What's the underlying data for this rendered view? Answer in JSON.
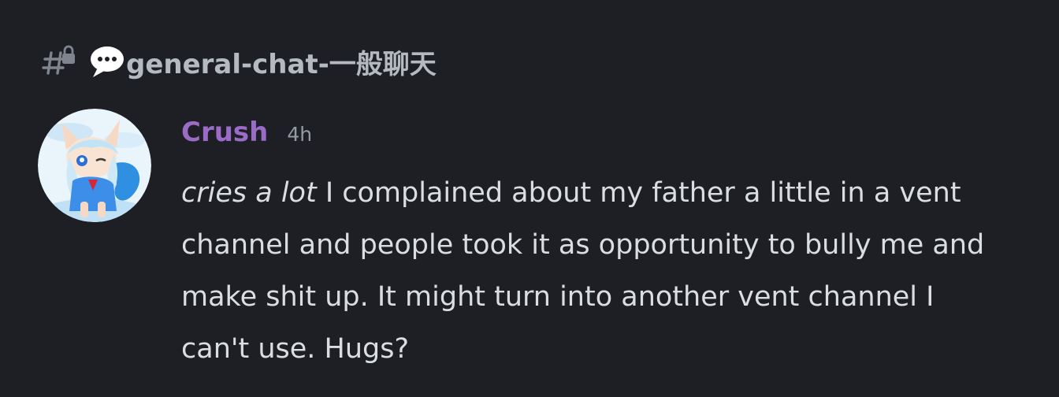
{
  "channel": {
    "icon": "locked-hash-icon",
    "emoji": "speech-balloon-icon",
    "name": "general-chat-一般聊天"
  },
  "message": {
    "author": "Crush",
    "author_color": "#9b6bc8",
    "timestamp": "4h",
    "avatar_icon": "anime-avatar",
    "italic_prefix": "cries a lot",
    "text": " I complained about my father a little in a vent channel and people took it as opportunity to bully me and make shit up. It might turn into another vent channel I can't use.  Hugs?"
  },
  "colors": {
    "background": "#1e1f25",
    "text": "#dbdee1",
    "muted": "#949ba4",
    "channel": "#b5bac1"
  }
}
